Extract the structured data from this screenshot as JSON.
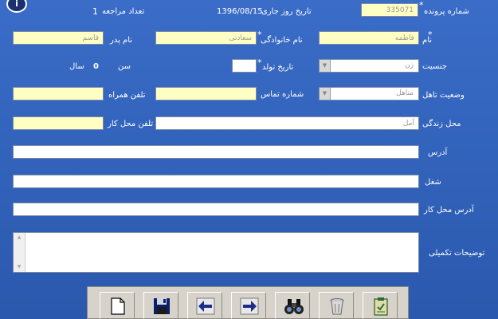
{
  "form": {
    "file_number_label": "شماره پرونده",
    "file_number_value": "335071",
    "current_date_label": "تاریخ روز جاری",
    "current_date_value": "1396/08/15",
    "visits_label": "تعداد مراجعه",
    "visits_value": "1",
    "first_name_label": "نام",
    "first_name_value": "فاطمه",
    "last_name_label": "نام خانوادگی",
    "last_name_value": "سعادتی",
    "father_name_label": "نام پدر",
    "father_name_value": "قاسم",
    "gender_label": "جنسیت",
    "gender_value": "زن",
    "birth_date_label": "تاریخ تولد",
    "birth_date_value": "",
    "age_label": "سن",
    "age_value": "0",
    "age_unit": "سال",
    "marital_label": "وضعیت تاهل",
    "marital_value": "متاهل",
    "contact_phone_label": "شماره تماس",
    "contact_phone_value": "",
    "mobile_label": "تلفن همراه",
    "mobile_value": "",
    "residence_label": "محل زندگی",
    "residence_value": "آمل",
    "work_phone_label": "تلفن محل کار",
    "work_phone_value": "",
    "address_label": "آدرس",
    "address_value": "",
    "job_label": "شغل",
    "job_value": "",
    "work_address_label": "آدرس محل کار",
    "work_address_value": "",
    "notes_label": "توضیحات تکمیلی",
    "notes_value": "",
    "required_mark": "*"
  },
  "icons": {
    "info": "i"
  },
  "toolbar": {
    "buttons": [
      "new-file",
      "save",
      "previous",
      "next",
      "search",
      "delete",
      "report"
    ]
  }
}
